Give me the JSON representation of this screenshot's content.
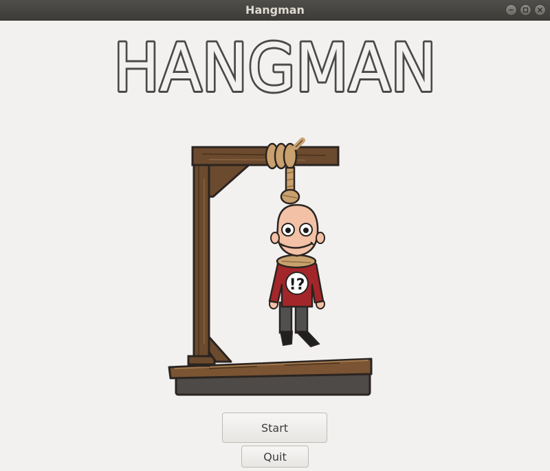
{
  "window": {
    "title": "Hangman"
  },
  "game": {
    "title": "HANGMAN",
    "illustration_icon": "hangman-gallows-illustration",
    "shirt_symbol": "!?"
  },
  "buttons": {
    "start_label": "Start",
    "quit_label": "Quit"
  },
  "colors": {
    "titlebar": "#3d3c38",
    "background": "#f2f1f0",
    "title_ink": "#4a4a4a",
    "wood": "#6b4a2e",
    "rope": "#c9a16e",
    "shirt": "#a3262a"
  }
}
